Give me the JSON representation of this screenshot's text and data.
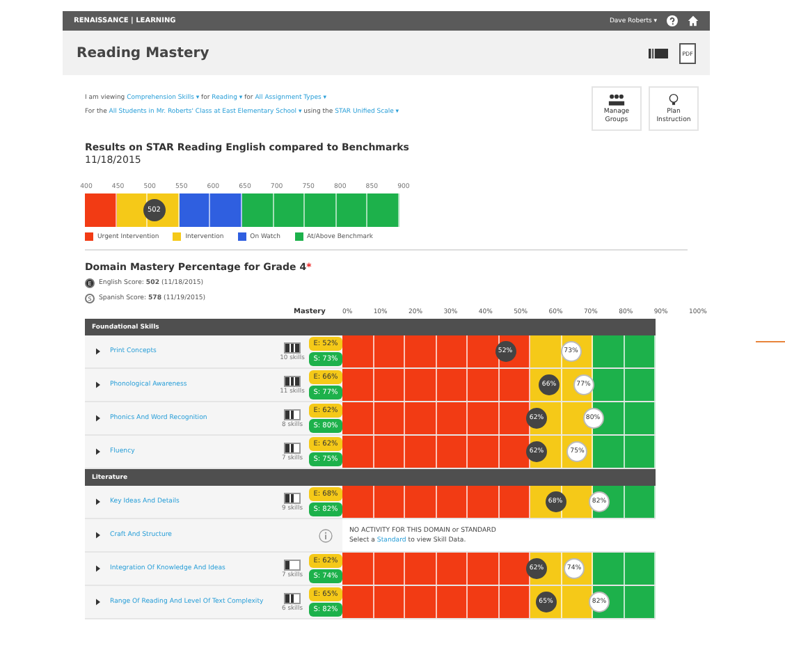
{
  "top_bar": {
    "logo": "RENAISSANCE | LEARNING",
    "user": "Dave Roberts ▾"
  },
  "header": {
    "title": "Reading Mastery",
    "pdf": "PDF"
  },
  "filters": {
    "lines": [
      [
        {
          "text": "I am viewing ",
          "link": false
        },
        {
          "text": "Comprehension Skills ▾",
          "link": true
        },
        {
          "text": " for ",
          "link": false
        },
        {
          "text": "Reading ▾",
          "link": true
        },
        {
          "text": " for ",
          "link": false
        },
        {
          "text": "All Assignment Types ▾",
          "link": true
        }
      ],
      [
        {
          "text": "For the ",
          "link": false
        },
        {
          "text": "All Students in Mr. Roberts' Class at East Elementary School ▾",
          "link": true
        },
        {
          "text": " using the ",
          "link": false
        },
        {
          "text": "STAR Unified Scale ▾",
          "link": true
        }
      ]
    ],
    "buttons": [
      "Manage Groups",
      "Plan Instruction"
    ]
  },
  "benchmarks": {
    "title": "Results on STAR Reading English compared to Benchmarks",
    "date": "11/18/2015",
    "ticks": [
      "400",
      "450",
      "500",
      "550",
      "600",
      "650",
      "700",
      "750",
      "800",
      "850",
      "900"
    ],
    "cells": [
      {
        "color": "#f23b14"
      },
      {
        "color": "#f5c918"
      },
      {
        "color": "#f5c918"
      },
      {
        "color": "#2f5fe0"
      },
      {
        "color": "#2f5fe0"
      },
      {
        "color": "#1db14b"
      },
      {
        "color": "#1db14b"
      },
      {
        "color": "#1db14b"
      },
      {
        "color": "#1db14b"
      },
      {
        "color": "#1db14b"
      }
    ],
    "marker": {
      "text": "502",
      "level": 0.22
    },
    "legend": [
      {
        "label": "Urgent Intervention",
        "color": "#f23b14"
      },
      {
        "label": "Intervention",
        "color": "#f5c918"
      },
      {
        "label": "On Watch",
        "color": "#2f5fe0"
      },
      {
        "label": "At/Above Benchmark",
        "color": "#1db14b"
      }
    ]
  },
  "domain": {
    "title": "Domain Mastery Percentage for Grade 4",
    "asterisk": "*",
    "scores": [
      {
        "badge": "E",
        "text": "English Score: **502** (11/18/2015)",
        "filled": true
      },
      {
        "badge": "S",
        "text": "Spanish Score: **578** (11/19/2015)",
        "filled": false
      }
    ],
    "mastery_label": "Mastery",
    "scale": [
      "0%",
      "10%",
      "20%",
      "30%",
      "40%",
      "50%",
      "60%",
      "70%",
      "80%",
      "90%",
      "100%"
    ],
    "zone_cells": [
      {
        "color": "#f23b14"
      },
      {
        "color": "#f23b14"
      },
      {
        "color": "#f23b14"
      },
      {
        "color": "#f23b14"
      },
      {
        "color": "#f23b14"
      },
      {
        "color": "#f23b14"
      },
      {
        "color": "#f5c918"
      },
      {
        "color": "#f5c918"
      },
      {
        "color": "#1db14b"
      },
      {
        "color": "#1db14b"
      }
    ],
    "groups": [
      {
        "name": "Foundational Skills",
        "rows": [
          {
            "kind": "scores",
            "name": "Print Concepts",
            "battery": {
              "level": 1
            },
            "skills": "10 skills",
            "e": {
              "pill": "E: 52%",
              "text": "52%"
            },
            "s": {
              "pill": "S: 73%",
              "text": "73%"
            }
          },
          {
            "kind": "scores",
            "name": "Phonological Awareness",
            "battery": {
              "level": 1
            },
            "skills": "11 skills",
            "e": {
              "pill": "E: 66%",
              "text": "66%"
            },
            "s": {
              "pill": "S: 77%",
              "text": "77%"
            }
          },
          {
            "kind": "scores",
            "name": "Phonics And Word Recognition",
            "battery": {
              "level": 0.67
            },
            "skills": "8 skills",
            "e": {
              "pill": "E: 62%",
              "text": "62%"
            },
            "s": {
              "pill": "S: 80%",
              "text": "80%"
            }
          },
          {
            "kind": "scores",
            "name": "Fluency",
            "battery": {
              "level": 0.67
            },
            "skills": "7 skills",
            "e": {
              "pill": "E: 62%",
              "text": "62%"
            },
            "s": {
              "pill": "S: 75%",
              "text": "75%"
            }
          }
        ]
      },
      {
        "name": "Literature",
        "rows": [
          {
            "kind": "scores",
            "name": "Key Ideas And Details",
            "battery": {
              "level": 0.67
            },
            "skills": "9 skills",
            "e": {
              "pill": "E: 68%",
              "text": "68%"
            },
            "s": {
              "pill": "S: 82%",
              "text": "82%"
            }
          },
          {
            "kind": "no_activity",
            "name": "Craft And Structure",
            "notice": "NO ACTIVITY FOR THIS DOMAIN or STANDARD",
            "hint": [
              {
                "text": "Select a ",
                "link": false
              },
              {
                "text": "Standard",
                "link": true
              },
              {
                "text": " to view Skill Data.",
                "link": false
              }
            ]
          },
          {
            "kind": "scores",
            "name": "Integration Of Knowledge And Ideas",
            "battery": {
              "level": 0.33
            },
            "skills": "7 skills",
            "e": {
              "pill": "E: 62%",
              "text": "62%"
            },
            "s": {
              "pill": "S: 74%",
              "text": "74%"
            }
          },
          {
            "kind": "scores",
            "name": "Range Of Reading And Level Of Text Complexity",
            "battery": {
              "level": 0.67
            },
            "skills": "6 skills",
            "e": {
              "pill": "E: 65%",
              "text": "65%"
            },
            "s": {
              "pill": "S: 82%",
              "text": "82%"
            }
          }
        ]
      }
    ]
  }
}
